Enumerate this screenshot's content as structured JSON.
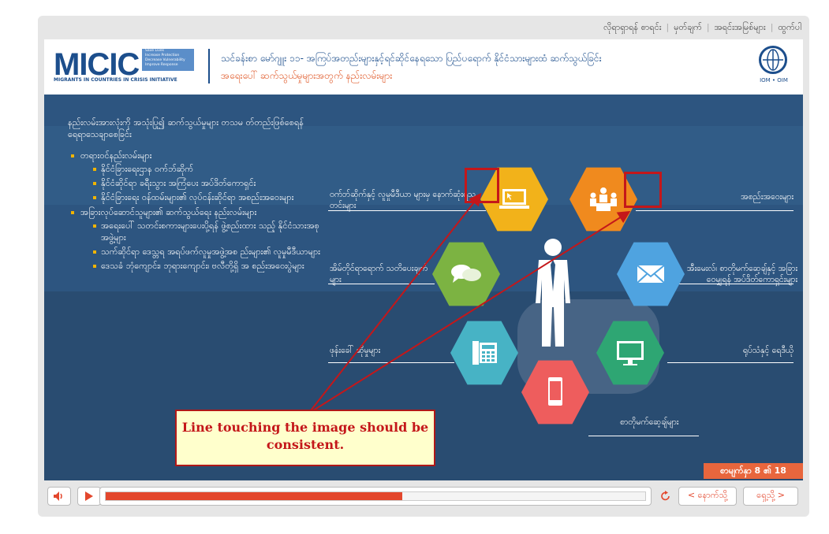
{
  "nav": {
    "items": [
      "လိုရာရှာရန် စာရင်း",
      "မှတ်ချက်",
      "အရင်းအမြစ်များ",
      "ထွက်ပါ"
    ]
  },
  "header": {
    "logo_text": "MICIC",
    "logo_tagline": [
      "Save Lives",
      "Increase Protection",
      "Decrease Vulnerability",
      "Improve Response"
    ],
    "logo_subtitle": "MIGRANTS IN COUNTRIES IN CRISIS INITIATIVE",
    "title": "သင်ခန်းစာ မော်ဂျူး ၁၁- အကြပ်အတည်းများနှင့်ရင်ဆိုင်နေရသော ပြည်ပရောက် နိုင်ငံသားများထံ ဆက်သွယ်ခြင်း",
    "subtitle": "အရေးပေါ် ဆက်သွယ်မှုများအတွက် နည်းလမ်းများ",
    "iom_label": "IOM • OIM"
  },
  "content": {
    "intro": "နည်းလမ်းအားလုံးကို အသုံးပြု၍ ဆက်သွယ်မှုများ တသမ တ်တည်းဖြစ်စေရန် ရေရာသေချာစေခြင်း",
    "bullets": [
      {
        "text": "တရားဝင်နည်းလမ်းများ",
        "sub": [
          "နိုင်ငံခြားရေးဌာန ဝက်ဘ်ဆိုက်",
          "နိုင်ငံဆိုင်ရာ ခရီးသွား အကြံပေး အပ်ဒိတ်ကောရှင်း",
          "နိုင်ငံခြားရေး ဝန်ထမ်းများ၏ လုပ်ငန်းဆိုင်ရာ အစည်းအဝေးများ"
        ]
      },
      {
        "text": "အခြားလုပ်ဆောင်သူများ၏ ဆက်သွယ်ရေး နည်းလမ်းများ",
        "sub": [
          "အရေးပေါ် သတင်းစကားများပေးပို့ရန် ဖွဲ့စည်းထား သည့် နိုင်ငံသားအစုအဖွဲ့များ",
          "သက်ဆိုင်ရာ ဒေသ္တရ အရပ်ဖက်လူမှုအဖွဲ့အစ ည်းများ၏ လူမှုမီဒီယာများ",
          "ဒေသခံ ဘုံကျောင်း၊ ဘုရားကျောင်း၊ ဗလီတို့ရှိ အ စည်းအဝေးပွဲများ"
        ]
      }
    ],
    "labels": {
      "web": "ဝက်ဘ်ဆိုက်နှင့် လူမှုမီဒီယာ များမှ နောက်ဆုံးရသတင်းများ",
      "meeting": "အစည်းအဝေးများ",
      "sms": "အိမ်တိုင်ရာရောက် သတိပေးချက်များ",
      "email": "အီးမေးလ်၊ စာတိုမက်ဆေ့ချ်နှင့် အခြားဝေမျှရန် အပ်ဒိတ်ကောရှင်းများ",
      "phone": "ဖုန်းခေါ် ဆိုမှုများ",
      "tv": "ရုပ်သံနှင့် ရေဒီယို",
      "mobile": "စာတိုမက်ဆေ့ချ်များ"
    },
    "callout": "Line touching the image should be consistent.",
    "page_indicator": "စာမျက်နှာ 8 ၏ 18"
  },
  "colors": {
    "web": "#f2b21a",
    "meeting": "#f08a1e",
    "sms": "#7cb342",
    "email": "#4fa3e0",
    "phone": "#47b3c5",
    "tv": "#2ea673",
    "mobile": "#ee5d5d",
    "accent": "#e3472d",
    "annotation": "#c4171a"
  },
  "icons": {
    "web": "laptop-icon",
    "meeting": "meeting-icon",
    "sms": "chat-bubbles-icon",
    "email": "envelope-icon",
    "phone": "desk-phone-icon",
    "tv": "monitor-icon",
    "mobile": "smartphone-icon",
    "center": "businessman-icon"
  },
  "controls": {
    "progress": 0.55,
    "back_label": "< နောက်သို့",
    "next_label": "ရှေ့သို့ >"
  }
}
